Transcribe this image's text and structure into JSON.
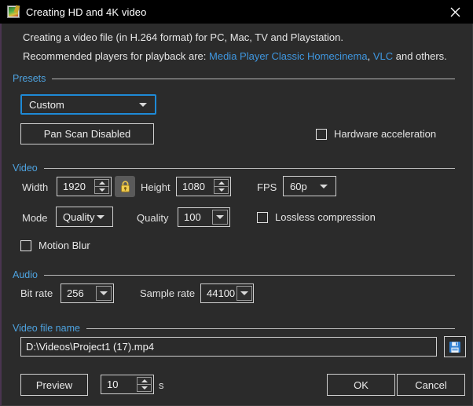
{
  "window": {
    "title": "Creating HD and 4K video",
    "icon": "image-export-icon",
    "close_label": "close-icon",
    "accent_blue": "#4ea3e0",
    "focus_blue": "#1e8ad6",
    "link_blue": "#3f97e0",
    "background": "#2b2b2b",
    "titlebar_background": "#000000"
  },
  "description": {
    "line1": "Creating a video file (in H.264 format) for PC, Mac, TV and Playstation.",
    "line2_prefix": "Recommended players for playback are: ",
    "link1": "Media Player Classic Homecinema",
    "separator": ", ",
    "link2": "VLC",
    "line2_suffix": " and others."
  },
  "presets": {
    "group_label": "Presets",
    "preset_value": "Custom",
    "pan_scan_label": "Pan  Scan Disabled",
    "hardware_acceleration": {
      "label": "Hardware acceleration",
      "checked": false
    }
  },
  "video": {
    "group_label": "Video",
    "width_label": "Width",
    "width_value": "1920",
    "lock_icon": "padlock-closed-icon",
    "lock_active": true,
    "height_label": "Height",
    "height_value": "1080",
    "fps_label": "FPS",
    "fps_value": "60p",
    "mode_label": "Mode",
    "mode_value": "Quality",
    "quality_label": "Quality",
    "quality_value": "100",
    "lossless": {
      "label": "Lossless compression",
      "checked": false
    },
    "motion_blur": {
      "label": "Motion Blur",
      "checked": false
    }
  },
  "audio": {
    "group_label": "Audio",
    "bitrate_label": "Bit rate",
    "bitrate_value": "256",
    "samplerate_label": "Sample rate",
    "samplerate_value": "44100"
  },
  "file": {
    "group_label": "Video file name",
    "path_value": "D:\\Videos\\Project1 (17).mp4",
    "browse_icon": "save-floppy-icon"
  },
  "footer": {
    "preview_label": "Preview",
    "preview_seconds": "10",
    "seconds_unit": "s",
    "ok_label": "OK",
    "cancel_label": "Cancel"
  }
}
